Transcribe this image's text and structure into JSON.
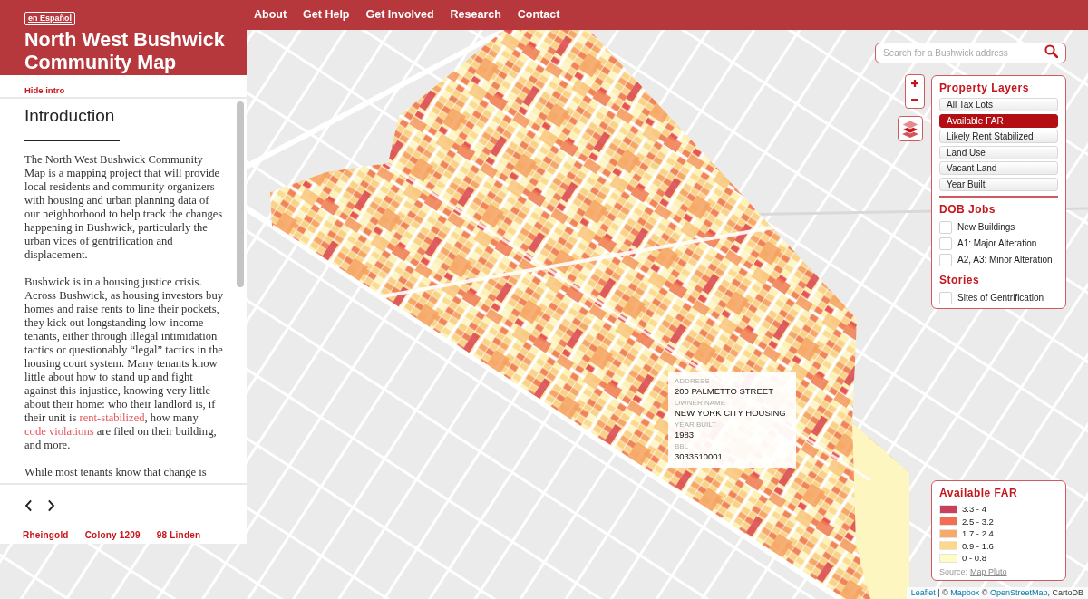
{
  "header": {
    "language_button": "en Español",
    "title": "North West Bushwick Community Map",
    "nav": [
      "About",
      "Get Help",
      "Get Involved",
      "Research",
      "Contact"
    ]
  },
  "intro_panel": {
    "hide_link": "Hide intro",
    "heading": "Introduction",
    "paragraphs": [
      [
        {
          "text": "The North West Bushwick Community Map is a mapping project that will provide local residents and community organizers with housing and urban planning data of our neighborhood to help track the changes happening in Bushwick, particularly the urban vices of gentrification and displacement."
        }
      ],
      [
        {
          "text": "Bushwick is in a housing justice crisis. Across Bushwick, as housing investors buy homes and raise rents to line their pockets, they kick out longstanding low-income tenants, either through illegal intimidation tactics or questionably “legal” tactics in the housing court system. Many tenants know little about how to stand up and fight against this injustice, knowing very little about their home: who their landlord is, if their unit is "
        },
        {
          "text": "rent-stabilized",
          "kind": "link"
        },
        {
          "text": ", how many "
        },
        {
          "text": "code violations",
          "kind": "link"
        },
        {
          "text": " are filed on their building, and more."
        }
      ],
      [
        {
          "text": "While most tenants know that change is"
        }
      ]
    ],
    "story_links": [
      "Rheingold",
      "Colony 1209",
      "98 Linden"
    ]
  },
  "map": {
    "search": {
      "placeholder": "Search for a Bushwick address"
    },
    "layers_panel": {
      "sections": [
        {
          "title": "Property Layers",
          "kind": "buttons",
          "items": [
            {
              "label": "All Tax Lots",
              "selected": false
            },
            {
              "label": "Available FAR",
              "selected": true
            },
            {
              "label": "Likely Rent Stabilized",
              "selected": false
            },
            {
              "label": "Land Use",
              "selected": false
            },
            {
              "label": "Vacant Land",
              "selected": false
            },
            {
              "label": "Year Built",
              "selected": false
            }
          ]
        },
        {
          "title": "DOB Jobs",
          "kind": "checkboxes",
          "items": [
            {
              "label": "New Buildings",
              "checked": false
            },
            {
              "label": "A1: Major Alteration",
              "checked": false
            },
            {
              "label": "A2, A3: Minor Alteration",
              "checked": false
            }
          ]
        },
        {
          "title": "Stories",
          "kind": "checkboxes",
          "items": [
            {
              "label": "Sites of Gentrification",
              "checked": false
            }
          ]
        }
      ]
    },
    "popup": {
      "fields": [
        {
          "label": "ADDRESS",
          "value": "200 PALMETTO STREET"
        },
        {
          "label": "OWNER NAME",
          "value": "NEW YORK CITY HOUSING"
        },
        {
          "label": "YEAR BUILT",
          "value": "1983"
        },
        {
          "label": "BBL",
          "value": "3033510001"
        }
      ]
    },
    "legend": {
      "title": "Available FAR",
      "items": [
        {
          "label": "3.3 - 4",
          "color": "#c9405b"
        },
        {
          "label": "2.5 - 3.2",
          "color": "#f26d53"
        },
        {
          "label": "1.7 - 2.4",
          "color": "#f8a968"
        },
        {
          "label": "0.9 - 1.6",
          "color": "#fcd888"
        },
        {
          "label": "0 - 0.8",
          "color": "#fefbc4"
        }
      ],
      "source": {
        "label": "Source:",
        "link": "Map Pluto"
      }
    },
    "attribution": [
      {
        "text": "Leaflet",
        "kind": "link"
      },
      {
        "text": " | © "
      },
      {
        "text": "Mapbox",
        "kind": "link"
      },
      {
        "text": " © "
      },
      {
        "text": "OpenStreetMap",
        "kind": "link"
      },
      {
        "text": ", CartoDB"
      }
    ]
  }
}
